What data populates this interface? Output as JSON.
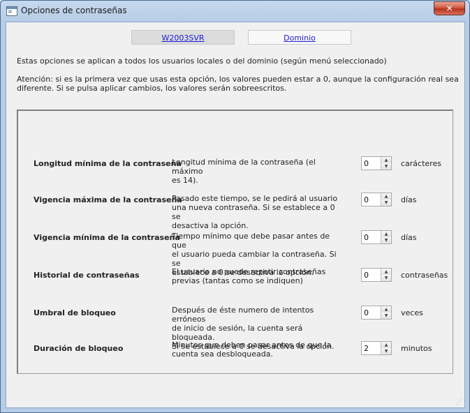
{
  "window": {
    "title": "Opciones de contraseñas",
    "close_label": "✕"
  },
  "tabs": [
    {
      "label": "W2003SVR"
    },
    {
      "label": "Dominio"
    }
  ],
  "info": {
    "line1": "Estas opciones se aplican a todos los usuarios locales o del dominio (según menú seleccionado)",
    "warning_line1": "Atención: si es la primera vez que usas esta opción, los valores pueden estar a 0, aunque la configuración real sea",
    "warning_line2": "diferente. Si se pulsa aplicar cambios, los valores serán sobreescritos."
  },
  "settings": [
    {
      "label": "Longitud mínima de la contraseña",
      "desc": [
        "Longitud mínima de la contraseña (el máximo",
        "es 14)."
      ],
      "value": "0",
      "unit": "carácteres"
    },
    {
      "label": "Vigencia máxima de la contraseña",
      "desc": [
        "Pasado este tiempo, se le pedirá al usuario",
        "una nueva contraseña. Si se establece a 0 se",
        "desactiva la opción."
      ],
      "value": "0",
      "unit": "días"
    },
    {
      "label": "Vigencia mínima de la contraseña",
      "desc": [
        "Tiempo mínimo que debe pasar antes de que",
        "el usuario pueda cambiar la contraseña. Si se",
        "establece a 0 se desactiva la opción."
      ],
      "value": "0",
      "unit": "días"
    },
    {
      "label": "Historial de contraseñas",
      "desc": [
        "El usuario no puede repetir contraseñas",
        "previas (tantas como se indiquen)"
      ],
      "value": "0",
      "unit": "contraseñas"
    },
    {
      "label": "Umbral de bloqueo",
      "desc": [
        "Después de éste numero de intentos erróneos",
        "de inicio de sesión, la cuenta será bloqueada.",
        "Si se establece a 0 se desactiva la opción."
      ],
      "value": "0",
      "unit": "veces"
    },
    {
      "label": "Duración de bloqueo",
      "desc": [
        "Minutos que deben pasar antes de que la",
        "cuenta sea desbloqueada."
      ],
      "value": "2",
      "unit": "minutos"
    }
  ]
}
